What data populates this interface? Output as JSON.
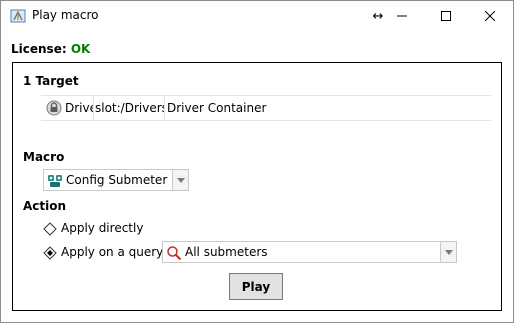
{
  "window": {
    "title": "Play macro",
    "resize_glyph": "↔",
    "minimize_icon": "minimize-icon",
    "maximize_icon": "maximize-icon",
    "close_icon": "close-icon"
  },
  "license": {
    "label": "License:",
    "status": "OK",
    "status_color": "#008000"
  },
  "target": {
    "heading": "1 Target",
    "row": {
      "icon": "driver-icon",
      "name": "Drive",
      "slot": "slot:/Drivers",
      "type": "Driver Container"
    }
  },
  "macro": {
    "heading": "Macro",
    "selected": "Config Submeter",
    "icon": "submeter-icon"
  },
  "action": {
    "heading": "Action",
    "options": [
      {
        "label": "Apply directly",
        "selected": false
      },
      {
        "label": "Apply on a query",
        "selected": true
      }
    ],
    "query": {
      "selected": "All submeters",
      "icon": "query-search-icon"
    }
  },
  "buttons": {
    "play": "Play"
  }
}
